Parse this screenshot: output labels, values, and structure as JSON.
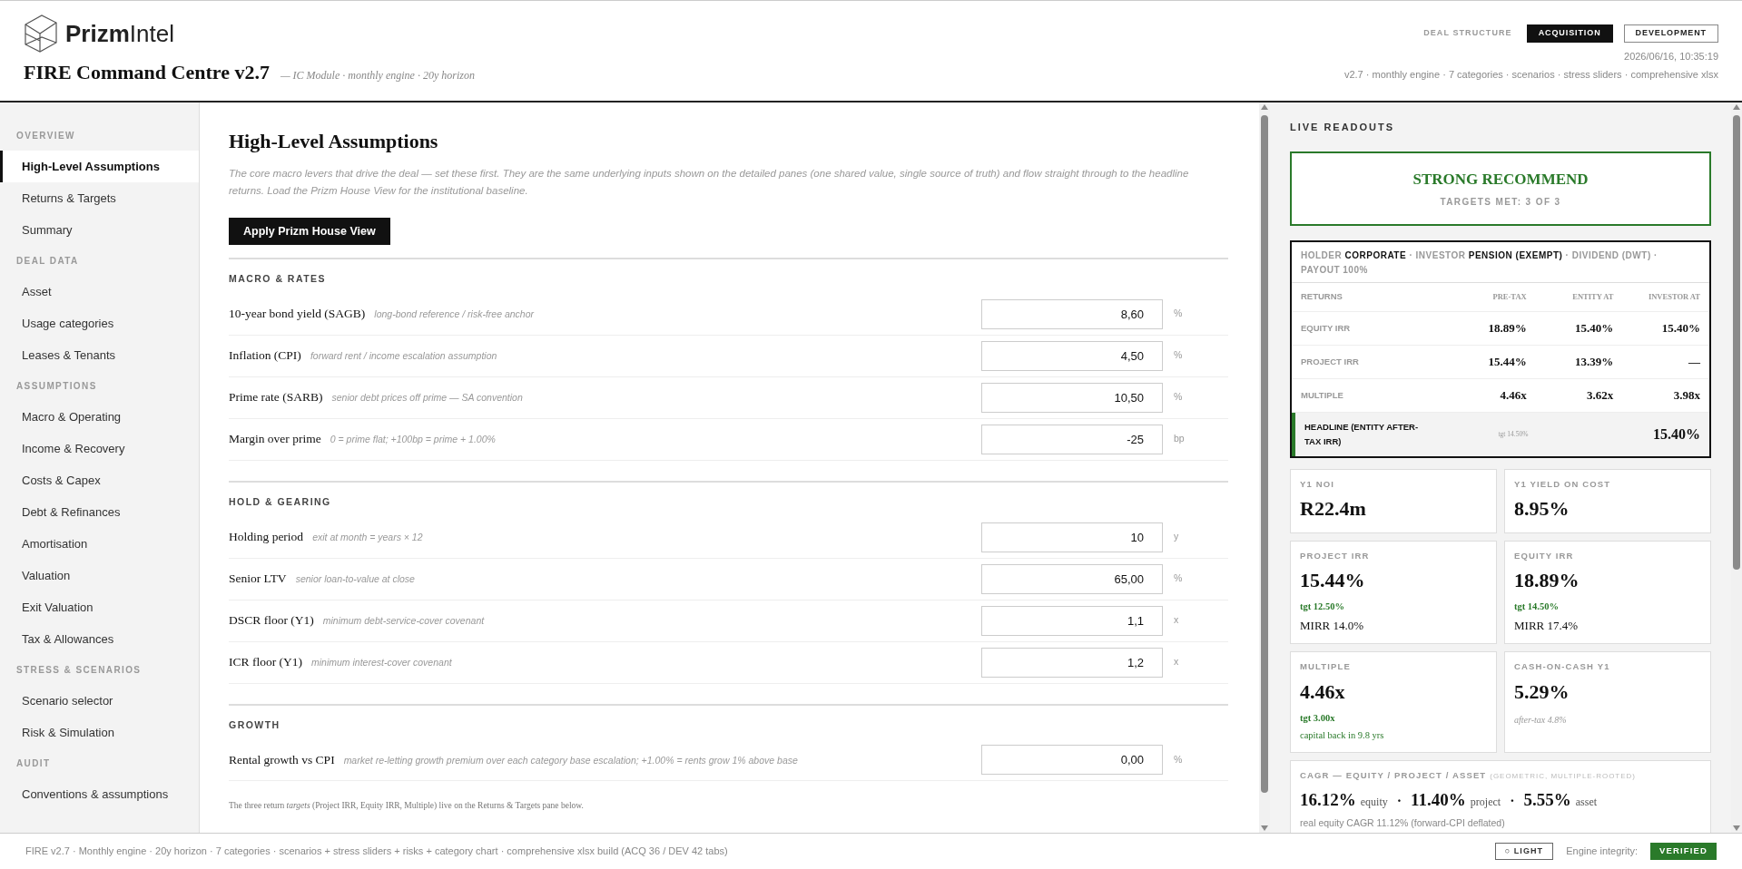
{
  "header": {
    "brand": "**Prizm**Intel",
    "title": "FIRE Command Centre v2.7",
    "subtitle": "— IC Module · monthly engine · 20y horizon",
    "deal_structure_label": "DEAL STRUCTURE",
    "deal_tabs": [
      {
        "label": "ACQUISITION",
        "selected": true
      },
      {
        "label": "DEVELOPMENT",
        "selected": false
      }
    ],
    "timestamp": "2026/06/16, 10:35:19",
    "info": "v2.7 · monthly engine · 7 categories · scenarios · stress sliders · comprehensive xlsx"
  },
  "sidebar": {
    "sections": [
      {
        "title": "OVERVIEW",
        "items": [
          {
            "label": "High-Level Assumptions",
            "selected": true
          },
          {
            "label": "Returns & Targets",
            "selected": false
          },
          {
            "label": "Summary",
            "selected": false
          }
        ]
      },
      {
        "title": "DEAL DATA",
        "items": [
          {
            "label": "Asset",
            "selected": false
          },
          {
            "label": "Usage categories",
            "selected": false
          },
          {
            "label": "Leases & Tenants",
            "selected": false
          }
        ]
      },
      {
        "title": "ASSUMPTIONS",
        "items": [
          {
            "label": "Macro & Operating",
            "selected": false
          },
          {
            "label": "Income & Recovery",
            "selected": false
          },
          {
            "label": "Costs & Capex",
            "selected": false
          },
          {
            "label": "Debt & Refinances",
            "selected": false
          },
          {
            "label": "Amortisation",
            "selected": false
          },
          {
            "label": "Valuation",
            "selected": false
          },
          {
            "label": "Exit Valuation",
            "selected": false
          },
          {
            "label": "Tax & Allowances",
            "selected": false
          }
        ]
      },
      {
        "title": "STRESS & SCENARIOS",
        "items": [
          {
            "label": "Scenario selector",
            "selected": false
          },
          {
            "label": "Risk & Simulation",
            "selected": false
          }
        ]
      },
      {
        "title": "AUDIT",
        "items": [
          {
            "label": "Conventions & assumptions",
            "selected": false
          }
        ]
      }
    ]
  },
  "main": {
    "title": "High-Level Assumptions",
    "description": "The core macro levers that drive the deal — set these first. They are the same underlying inputs shown on the detailed panes (one shared value, single source of truth) and flow straight through to the headline returns. Load the Prizm House View for the institutional baseline.",
    "button": "Apply Prizm House View",
    "groups": [
      {
        "title": "MACRO & RATES",
        "rows": [
          {
            "label": "10-year bond yield (SAGB)",
            "hint": "long-bond reference / risk-free anchor",
            "value": "8,60",
            "unit": "%"
          },
          {
            "label": "Inflation (CPI)",
            "hint": "forward rent / income escalation assumption",
            "value": "4,50",
            "unit": "%"
          },
          {
            "label": "Prime rate (SARB)",
            "hint": "senior debt prices off prime — SA convention",
            "value": "10,50",
            "unit": "%"
          },
          {
            "label": "Margin over prime",
            "hint": "0 = prime flat; +100bp = prime + 1.00%",
            "value": "-25",
            "unit": "bp"
          }
        ]
      },
      {
        "title": "HOLD & GEARING",
        "rows": [
          {
            "label": "Holding period",
            "hint": "exit at month = years × 12",
            "value": "10",
            "unit": "y"
          },
          {
            "label": "Senior LTV",
            "hint": "senior loan-to-value at close",
            "value": "65,00",
            "unit": "%"
          },
          {
            "label": "DSCR floor (Y1)",
            "hint": "minimum debt-service-cover covenant",
            "value": "1,1",
            "unit": "x"
          },
          {
            "label": "ICR floor (Y1)",
            "hint": "minimum interest-cover covenant",
            "value": "1,2",
            "unit": "x"
          }
        ]
      },
      {
        "title": "GROWTH",
        "rows": [
          {
            "label": "Rental growth vs CPI",
            "hint": "market re-letting growth premium over each category base escalation; +1.00% = rents grow 1% above base",
            "value": "0,00",
            "unit": "%"
          }
        ]
      }
    ],
    "footnote": "The three return *targets* (Project IRR, Equity IRR, Multiple) live on the Returns & Targets pane below."
  },
  "readouts": {
    "title": "LIVE READOUTS",
    "verdict": "STRONG RECOMMEND",
    "targets_met": "TARGETS MET: 3 OF 3",
    "returns_table": {
      "holder_line": "HOLDER **CORPORATE** · INVESTOR **PENSION (EXEMPT)** · DIVIDEND (DWT) · PAYOUT 100%",
      "columns": [
        "RETURNS",
        "PRE-TAX",
        "ENTITY AT",
        "INVESTOR AT"
      ],
      "rows": [
        {
          "kind": "normal",
          "cells": [
            "EQUITY IRR",
            "18.89%",
            "15.40%",
            "15.40%"
          ]
        },
        {
          "kind": "normal",
          "cells": [
            "PROJECT IRR",
            "15.44%",
            "13.39%",
            "—"
          ]
        },
        {
          "kind": "normal",
          "cells": [
            "MULTIPLE",
            "4.46x",
            "3.62x",
            "3.98x"
          ]
        },
        {
          "kind": "headline",
          "cells": [
            "HEADLINE (ENTITY AFTER-TAX IRR)",
            "tgt 14.50%",
            "",
            "15.40%"
          ]
        }
      ]
    },
    "cards": [
      {
        "label": "Y1 NOI",
        "value": "R22.4m"
      },
      {
        "label": "Y1 YIELD ON COST",
        "value": "8.95%"
      },
      {
        "label": "PROJECT IRR",
        "value": "15.44%",
        "notes": [
          {
            "kind": "target",
            "text": "tgt 12.50%"
          },
          {
            "kind": "mirr",
            "text": "MIRR 14.0%"
          }
        ]
      },
      {
        "label": "EQUITY IRR",
        "value": "18.89%",
        "notes": [
          {
            "kind": "target",
            "text": "tgt 14.50%"
          },
          {
            "kind": "mirr",
            "text": "MIRR 17.4%"
          }
        ]
      },
      {
        "label": "MULTIPLE",
        "value": "4.46x",
        "notes": [
          {
            "kind": "target",
            "text": "tgt 3.00x"
          },
          {
            "kind": "good",
            "text": "capital back in 9.8 yrs"
          }
        ]
      },
      {
        "label": "CASH-ON-CASH Y1",
        "value": "5.29%",
        "notes": [
          {
            "kind": "muted",
            "text": "after-tax 4.8%"
          }
        ]
      }
    ],
    "cagr": {
      "title": "CAGR — EQUITY / PROJECT / ASSET",
      "qualifier": "(GEOMETRIC, MULTIPLE-ROOTED)",
      "values": [
        {
          "value": "16.12%",
          "label": "equity"
        },
        {
          "value": "11.40%",
          "label": "project"
        },
        {
          "value": "5.55%",
          "label": "asset"
        }
      ],
      "separator": "·",
      "note": "real equity CAGR 11.12% (forward-CPI deflated)"
    }
  },
  "footer": {
    "text": "FIRE v2.7 · Monthly engine · 20y horizon · 7 categories · scenarios + stress sliders + risks + category chart · comprehensive xlsx build (ACQ 36 / DEV 42 tabs)",
    "theme_button": "○ LIGHT",
    "integrity_label": "Engine integrity:",
    "integrity_badge": "VERIFIED"
  }
}
